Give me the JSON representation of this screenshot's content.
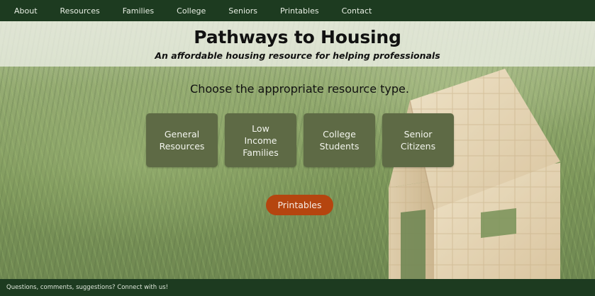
{
  "nav": {
    "items": [
      {
        "label": "About"
      },
      {
        "label": "Resources"
      },
      {
        "label": "Families"
      },
      {
        "label": "College"
      },
      {
        "label": "Seniors"
      },
      {
        "label": "Printables"
      },
      {
        "label": "Contact"
      }
    ]
  },
  "header": {
    "title": "Pathways to Housing",
    "subtitle": "An affordable housing resource for helping professionals"
  },
  "main": {
    "prompt": "Choose the appropriate resource type.",
    "cards": [
      {
        "label": "General\nResources"
      },
      {
        "label": "Low\nIncome\nFamilies"
      },
      {
        "label": "College\nStudents"
      },
      {
        "label": "Senior\nCitizens"
      }
    ],
    "printables_button": "Printables"
  },
  "footer": {
    "text": "Questions, comments, suggestions? Connect with us!"
  },
  "colors": {
    "nav_bg": "#1d3b20",
    "card_bg": "#5e6a45",
    "button_bg": "#b5450f"
  }
}
